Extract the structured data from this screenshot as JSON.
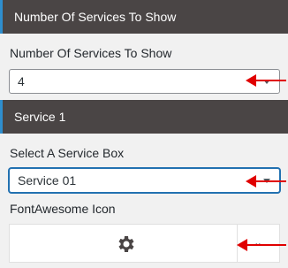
{
  "sections": {
    "services_count_header": "Number Of Services To Show",
    "service1_header": "Service 1"
  },
  "fields": {
    "services_count": {
      "label": "Number Of Services To Show",
      "value": "4"
    },
    "service_box": {
      "label": "Select A Service Box",
      "value": "Service 01"
    },
    "fontawesome_icon": {
      "label": "FontAwesome Icon",
      "selected_icon": "gear-icon"
    }
  },
  "colors": {
    "header_bg": "#4a4545",
    "accent": "#2e8ece",
    "focus_border": "#2271b1",
    "annotation_arrow": "#e00000",
    "panel_bg": "#f1f1f1"
  }
}
